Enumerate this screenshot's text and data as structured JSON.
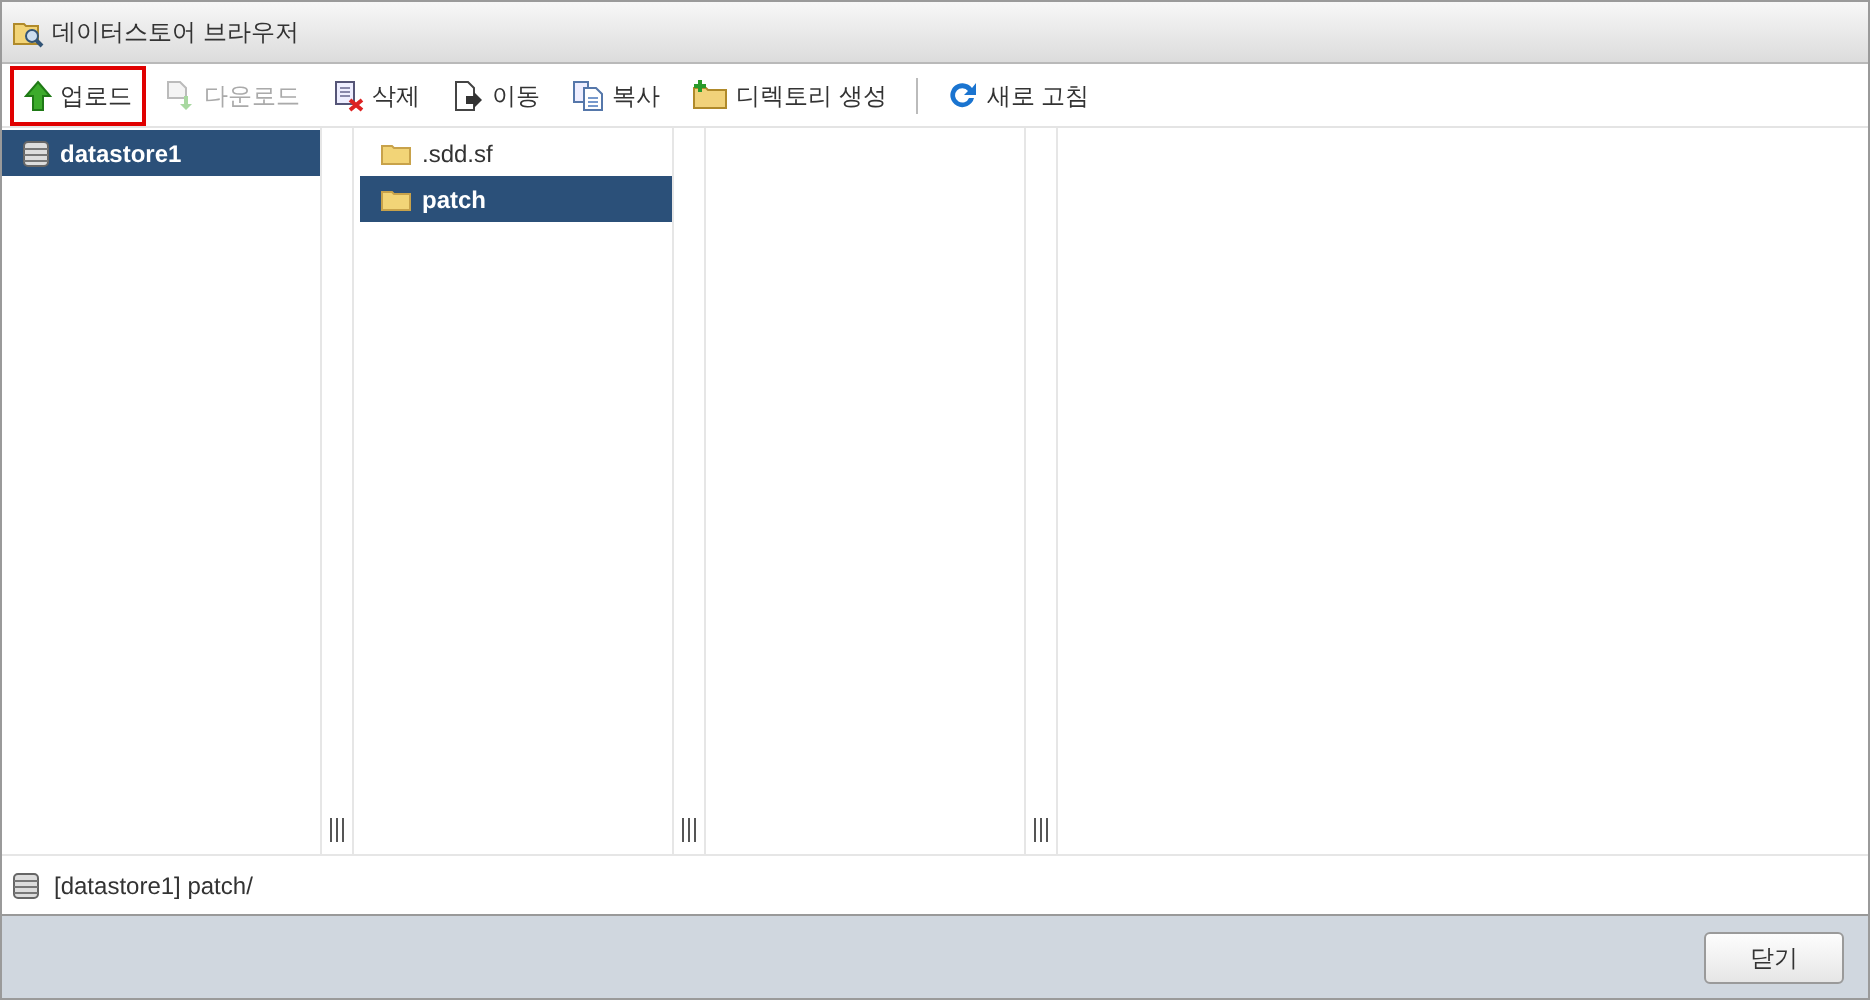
{
  "window": {
    "title": "데이터스토어 브라우저"
  },
  "toolbar": [
    {
      "kind": "tool",
      "label": "업로드",
      "disabled": false,
      "highlighted": true
    },
    {
      "kind": "tool",
      "label": "다운로드",
      "disabled": true,
      "highlighted": false
    },
    {
      "kind": "tool",
      "label": "삭제",
      "disabled": false,
      "highlighted": false
    },
    {
      "kind": "tool",
      "label": "이동",
      "disabled": false,
      "highlighted": false
    },
    {
      "kind": "tool",
      "label": "복사",
      "disabled": false,
      "highlighted": false
    },
    {
      "kind": "tool",
      "label": "디렉토리 생성",
      "disabled": false,
      "highlighted": false
    },
    {
      "kind": "separator"
    },
    {
      "kind": "tool",
      "label": "새로 고침",
      "disabled": false,
      "highlighted": false
    }
  ],
  "columns": [
    {
      "kind": "list",
      "items": [
        {
          "kind": "datastore",
          "label": "datastore1",
          "selected": true
        }
      ]
    },
    {
      "kind": "list",
      "items": [
        {
          "kind": "folder",
          "label": ".sdd.sf",
          "selected": false
        },
        {
          "kind": "folder",
          "label": "patch",
          "selected": true
        }
      ]
    },
    {
      "kind": "empty"
    },
    {
      "kind": "empty"
    }
  ],
  "path": {
    "label": "[datastore1] patch/"
  },
  "buttons": [
    {
      "label": "닫기"
    }
  ]
}
